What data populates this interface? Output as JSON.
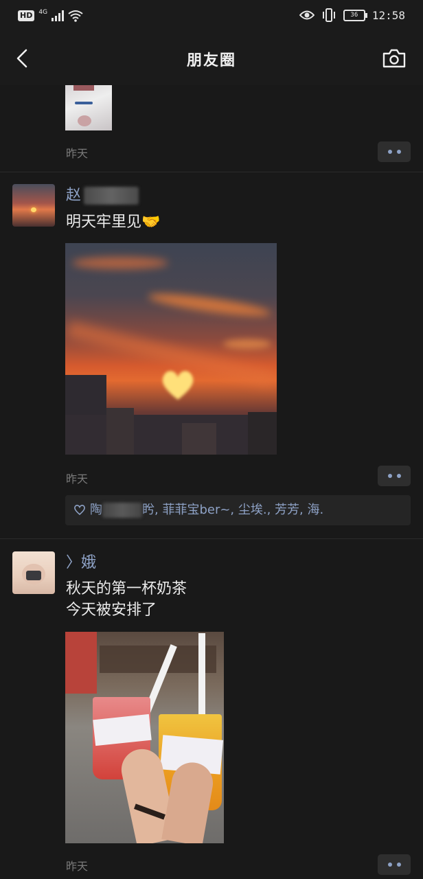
{
  "status_bar": {
    "hd": "HD",
    "network": "4G",
    "battery": "36",
    "time": "12:58"
  },
  "nav": {
    "title": "朋友圈",
    "back_icon": "back-arrow-icon",
    "camera_icon": "camera-icon"
  },
  "posts": [
    {
      "time": "昨天",
      "more_icon": "more-dots-icon"
    },
    {
      "name_visible": "赵",
      "text": "明天牢里见🤝",
      "time": "昨天",
      "more_icon": "more-dots-icon",
      "likes": {
        "icon": "heart-icon",
        "first_name_visible": "陶",
        "rest": "盻, 菲菲宝ber~, 尘埃., 芳芳, 海."
      }
    },
    {
      "name": "〉娥",
      "text_line1": "秋天的第一杯奶茶",
      "text_line2": "今天被安排了",
      "time": "昨天",
      "more_icon": "more-dots-icon"
    }
  ],
  "colors": {
    "background": "#191919",
    "name_link": "#8ea2c6",
    "timestamp": "#7a7a7a"
  }
}
